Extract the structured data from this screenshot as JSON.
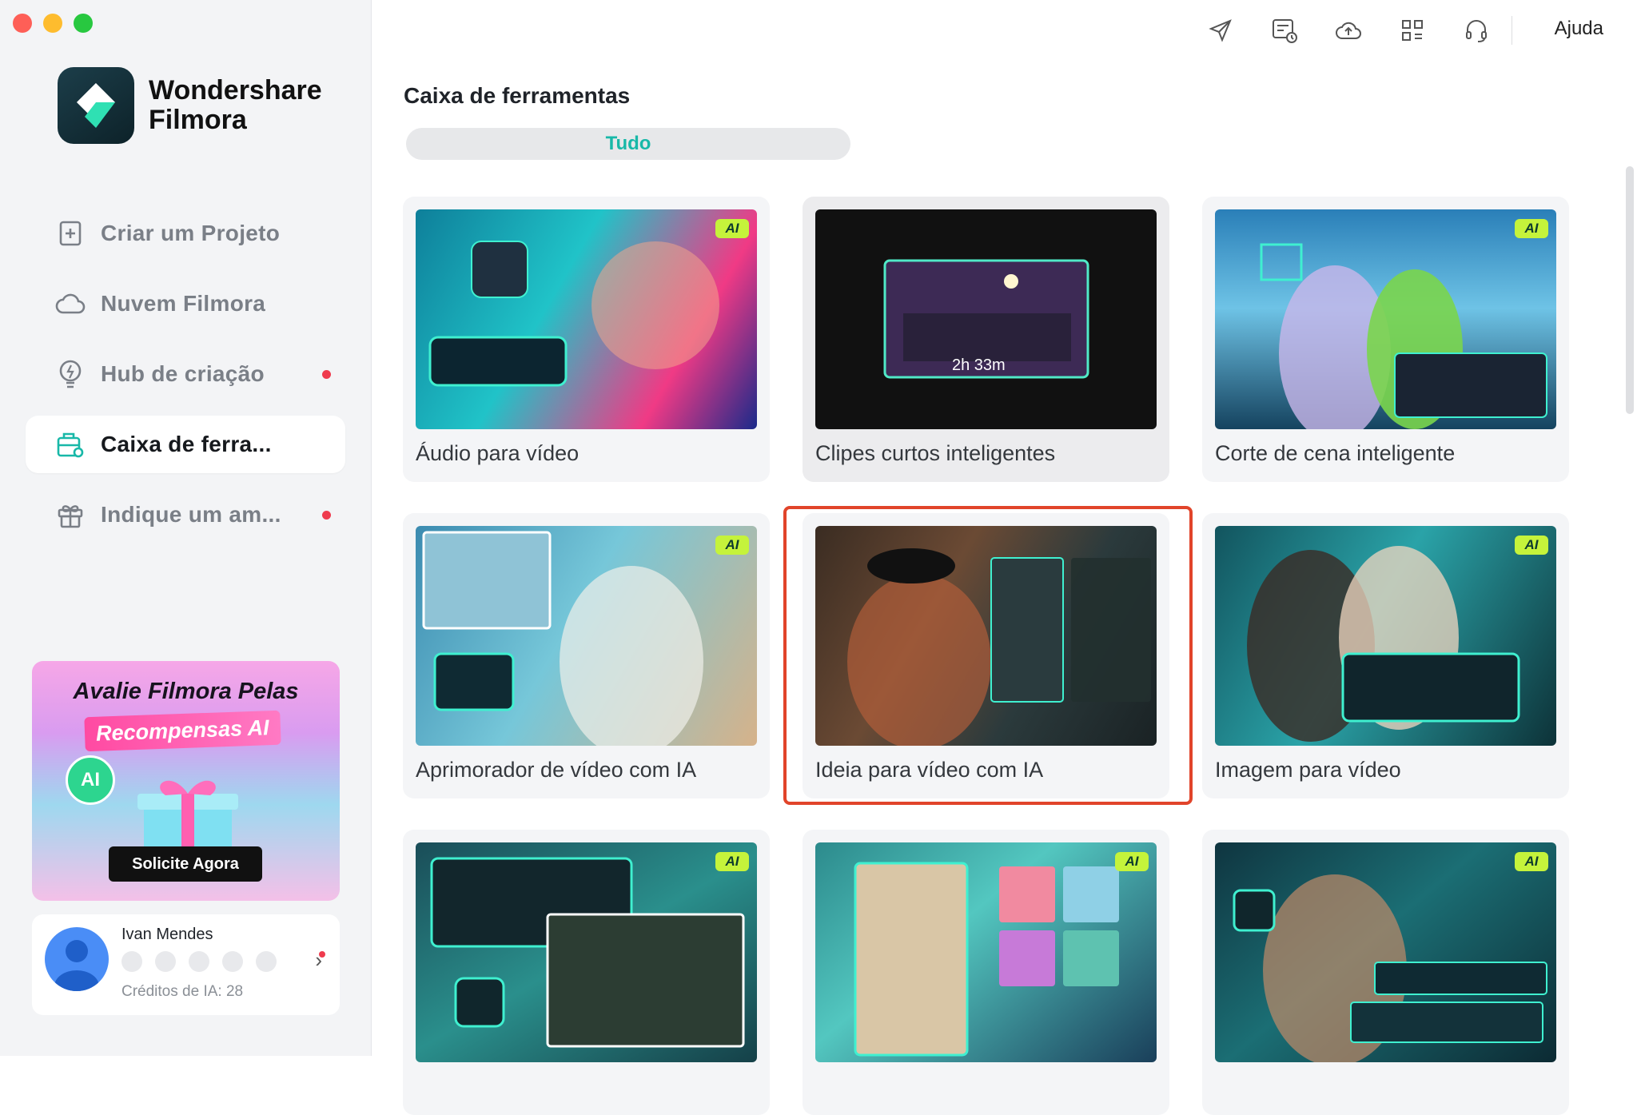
{
  "app": {
    "brand_line1": "Wondershare",
    "brand_line2": "Filmora",
    "colors": {
      "accent": "#18b8a8",
      "highlight": "#e1442a",
      "ai_badge": "#c5f33b",
      "dot": "#ef3b4e"
    }
  },
  "sidebar": {
    "items": [
      {
        "label": "Criar um Projeto",
        "icon": "plus-square-icon",
        "active": false,
        "dot": false
      },
      {
        "label": "Nuvem Filmora",
        "icon": "cloud-icon",
        "active": false,
        "dot": false
      },
      {
        "label": "Hub de criação",
        "icon": "bulb-icon",
        "active": false,
        "dot": true
      },
      {
        "label": "Caixa de ferra...",
        "icon": "toolbox-icon",
        "active": true,
        "dot": false
      },
      {
        "label": "Indique um am...",
        "icon": "gift-icon",
        "active": false,
        "dot": true
      }
    ],
    "promo": {
      "title": "Avalie Filmora Pelas",
      "subtitle": "Recompensas AI",
      "ai_badge": "AI",
      "button": "Solicite Agora"
    },
    "user": {
      "name": "Ivan Mendes",
      "credits": "Créditos de IA: 28",
      "chevron": "›"
    }
  },
  "topbar": {
    "icons": [
      "send-icon",
      "task-list-icon",
      "cloud-upload-icon",
      "grid-icon",
      "headset-icon"
    ],
    "help_label": "Ajuda"
  },
  "main": {
    "title": "Caixa de ferramentas",
    "filter": "Tudo",
    "cards": [
      {
        "label": "Áudio para vídeo",
        "ai": true,
        "badge": "AI"
      },
      {
        "label": "Clipes curtos inteligentes",
        "ai": false,
        "duration": "2h 33m"
      },
      {
        "label": "Corte de cena inteligente",
        "ai": true,
        "badge": "AI"
      },
      {
        "label": "Aprimorador de vídeo com IA",
        "ai": true,
        "badge": "AI"
      },
      {
        "label": "Ideia para vídeo com IA",
        "ai": false,
        "highlighted": true
      },
      {
        "label": "Imagem para vídeo",
        "ai": true,
        "badge": "AI"
      },
      {
        "label": "",
        "ai": true,
        "badge": "AI"
      },
      {
        "label": "",
        "ai": true,
        "badge": "AI"
      },
      {
        "label": "",
        "ai": true,
        "badge": "AI"
      }
    ]
  }
}
